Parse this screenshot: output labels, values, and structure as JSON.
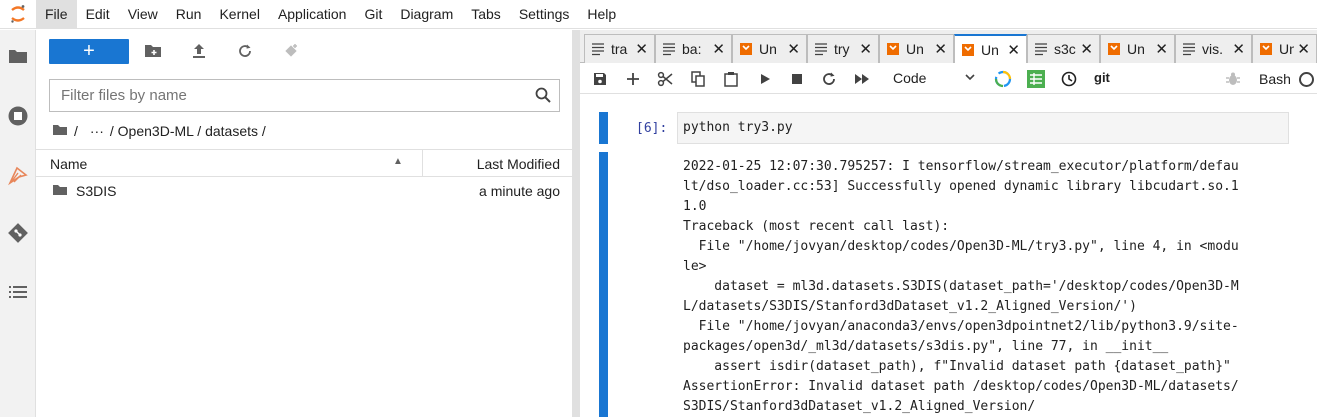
{
  "menubar": {
    "items": [
      "File",
      "Edit",
      "View",
      "Run",
      "Kernel",
      "Application",
      "Git",
      "Diagram",
      "Tabs",
      "Settings",
      "Help"
    ],
    "active": "File"
  },
  "rail": {
    "icons": [
      "folder-icon",
      "running-icon",
      "extension-icon",
      "git-icon",
      "toc-icon"
    ]
  },
  "filebrowser": {
    "new_label": "+",
    "filter_placeholder": "Filter files by name",
    "breadcrumb": {
      "root": "/",
      "ellipsis": "···",
      "path": "/ Open3D-ML / datasets /"
    },
    "columns": {
      "name": "Name",
      "modified": "Last Modified"
    },
    "files": [
      {
        "name": "S3DIS",
        "modified": "a minute ago",
        "icon": "folder-icon"
      }
    ]
  },
  "tabs": [
    {
      "label": "tra",
      "icon": "text-file-icon"
    },
    {
      "label": "ba:",
      "icon": "text-file-icon"
    },
    {
      "label": "Un",
      "icon": "notebook-icon"
    },
    {
      "label": "try",
      "icon": "text-file-icon"
    },
    {
      "label": "Un",
      "icon": "notebook-icon"
    },
    {
      "label": "Un",
      "icon": "notebook-icon",
      "active": true
    },
    {
      "label": "s3c",
      "icon": "text-file-icon"
    },
    {
      "label": "Un",
      "icon": "notebook-icon"
    },
    {
      "label": "vis.",
      "icon": "text-file-icon"
    },
    {
      "label": "Un",
      "icon": "notebook-icon"
    }
  ],
  "notebook_toolbar": {
    "cell_type": "Code",
    "git_label": "git",
    "kernel": "Bash"
  },
  "cell": {
    "prompt": "[6]:",
    "input": "python try3.py",
    "output": "2022-01-25 12:07:30.795257: I tensorflow/stream_executor/platform/defau\nlt/dso_loader.cc:53] Successfully opened dynamic library libcudart.so.1\n1.0\nTraceback (most recent call last):\n  File \"/home/jovyan/desktop/codes/Open3D-ML/try3.py\", line 4, in <modu\nle>\n    dataset = ml3d.datasets.S3DIS(dataset_path='/desktop/codes/Open3D-M\nL/datasets/S3DIS/Stanford3dDataset_v1.2_Aligned_Version/')\n  File \"/home/jovyan/anaconda3/envs/open3dpointnet2/lib/python3.9/site-\npackages/open3d/_ml3d/datasets/s3dis.py\", line 77, in __init__\n    assert isdir(dataset_path), f\"Invalid dataset path {dataset_path}\"\nAssertionError: Invalid dataset path /desktop/codes/Open3D-ML/datasets/\nS3DIS/Stanford3dDataset_v1.2_Aligned_Version/"
  },
  "colors": {
    "accent": "#1976d2",
    "logo_orange": "#f37726",
    "notebook_orange": "#ef6c00",
    "toolbar_green": "#4caf50"
  }
}
